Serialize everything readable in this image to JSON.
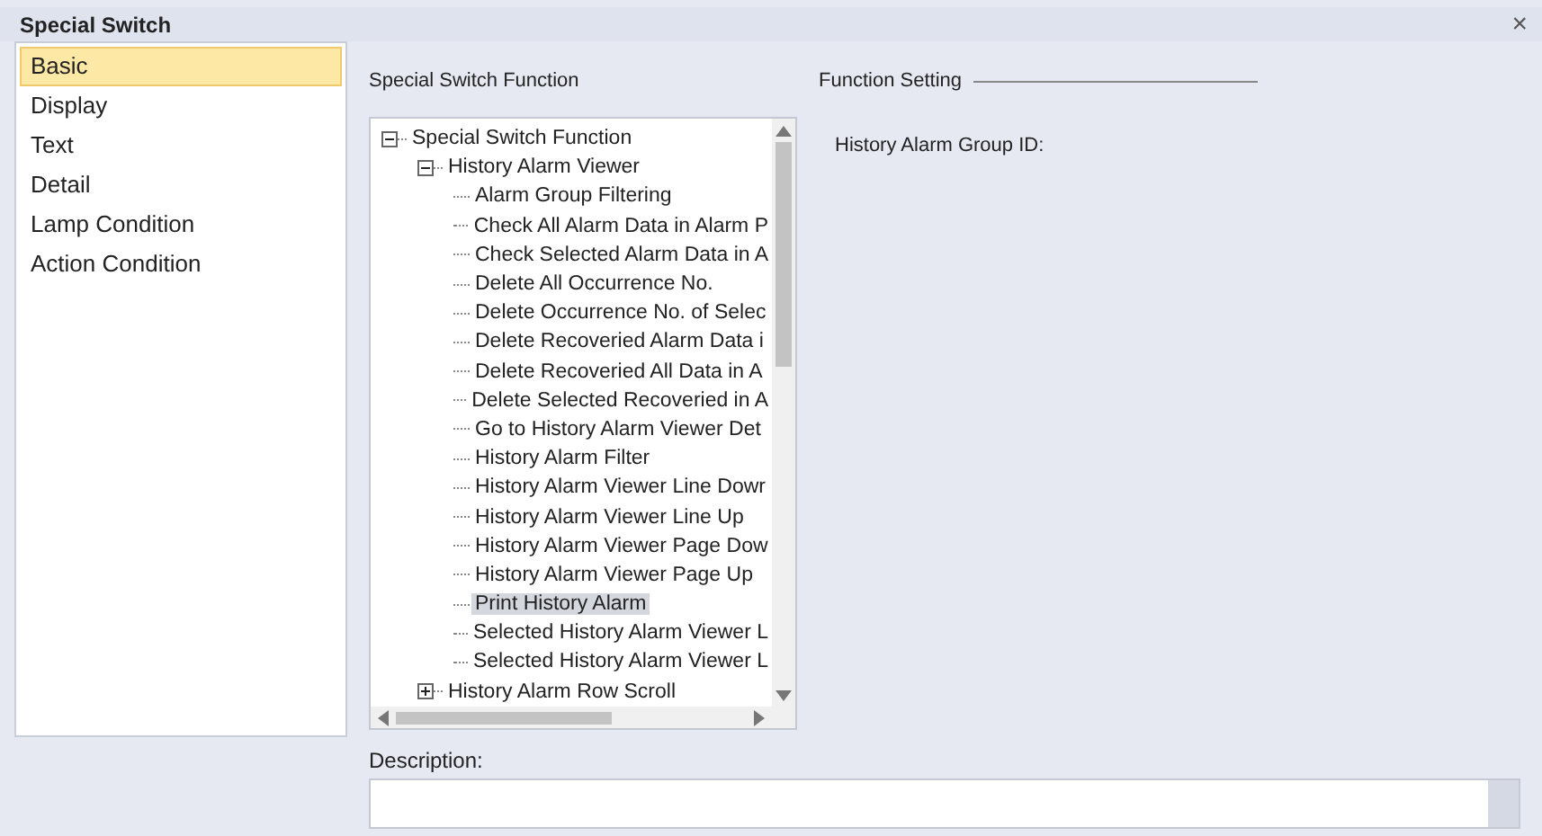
{
  "window": {
    "title": "Special Switch",
    "close": "×"
  },
  "sidebar": {
    "items": [
      {
        "label": "Basic",
        "selected": true
      },
      {
        "label": "Display",
        "selected": false
      },
      {
        "label": "Text",
        "selected": false
      },
      {
        "label": "Detail",
        "selected": false
      },
      {
        "label": "Lamp Condition",
        "selected": false
      },
      {
        "label": "Action Condition",
        "selected": false
      }
    ]
  },
  "function_panel": {
    "title": "Special Switch Function",
    "tree": [
      {
        "label": "Special Switch Function",
        "expanded": true,
        "selected": false,
        "children": [
          {
            "label": "History Alarm Viewer",
            "expanded": true,
            "selected": false,
            "children": [
              {
                "label": "Alarm Group Filtering",
                "selected": false
              },
              {
                "label": "Check All Alarm Data in Alarm P",
                "selected": false
              },
              {
                "label": "Check Selected Alarm Data in A",
                "selected": false
              },
              {
                "label": "Delete All Occurrence No.",
                "selected": false
              },
              {
                "label": "Delete Occurrence No. of Selec",
                "selected": false
              },
              {
                "label": "Delete Recoveried Alarm Data i",
                "selected": false
              },
              {
                "label": "Delete Recoveried All Data in A",
                "selected": false
              },
              {
                "label": "Delete Selected Recoveried in A",
                "selected": false
              },
              {
                "label": "Go to History Alarm Viewer Det",
                "selected": false
              },
              {
                "label": "History Alarm Filter",
                "selected": false
              },
              {
                "label": "History Alarm Viewer Line Dowr",
                "selected": false
              },
              {
                "label": "History Alarm Viewer Line Up",
                "selected": false
              },
              {
                "label": "History Alarm Viewer Page Dow",
                "selected": false
              },
              {
                "label": "History Alarm Viewer Page Up",
                "selected": false
              },
              {
                "label": "Print History Alarm",
                "selected": true
              },
              {
                "label": "Selected History Alarm Viewer L",
                "selected": false
              },
              {
                "label": "Selected History Alarm Viewer L",
                "selected": false
              }
            ]
          },
          {
            "label": "History Alarm Row Scroll",
            "expanded": false,
            "selected": false
          }
        ]
      }
    ]
  },
  "function_setting": {
    "title": "Function Setting",
    "fields": [
      {
        "label": "History Alarm Group ID:"
      }
    ]
  },
  "description": {
    "label": "Description:"
  }
}
